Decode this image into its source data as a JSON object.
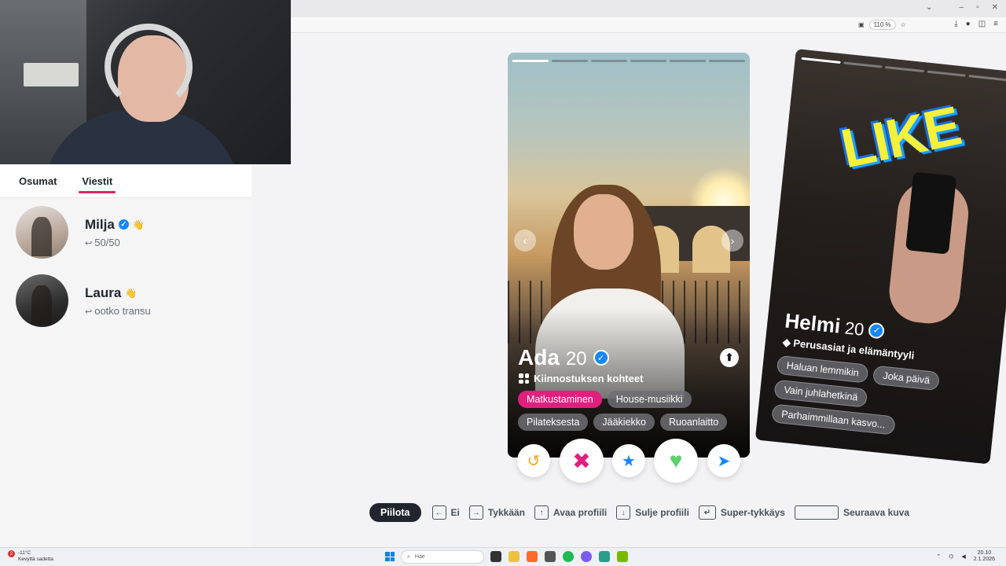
{
  "browser": {
    "zoom": "110 %",
    "tab_menu_icon": "chevron-down-icon",
    "window_controls": [
      "–",
      "▫",
      "✕"
    ]
  },
  "sidebar": {
    "tabs": [
      {
        "label": "Osumat",
        "active": false
      },
      {
        "label": "Viestit",
        "active": true
      }
    ],
    "messages": [
      {
        "name": "Milja",
        "verified": true,
        "preview": "50/50"
      },
      {
        "name": "Laura",
        "verified": false,
        "preview": "ootko transu"
      }
    ]
  },
  "card": {
    "name": "Ada",
    "age": "20",
    "verified": true,
    "interests_title": "Kiinnostuksen kohteet",
    "interests": [
      {
        "label": "Matkustaminen",
        "highlight": true
      },
      {
        "label": "House-musiikki",
        "highlight": false
      },
      {
        "label": "Pilateksesta",
        "highlight": false
      },
      {
        "label": "Jääkiekko",
        "highlight": false
      },
      {
        "label": "Ruoanlaitto",
        "highlight": false
      }
    ],
    "photo_count": 6,
    "photo_index": 1
  },
  "actions": {
    "rewind_icon": "rewind-icon",
    "nope_icon": "x-icon",
    "super_like_icon": "star-icon",
    "like_icon": "heart-icon",
    "boost_icon": "send-icon",
    "colors": {
      "rewind": "#f5a623",
      "nope": "#e0207e",
      "super_like": "#1786ff",
      "like": "#5ad16b",
      "boost": "#1786ff"
    }
  },
  "next_card": {
    "stamp": "LIKE",
    "name": "Helmi",
    "age": "20",
    "subtitle": "Perusasiat ja elämäntyyli",
    "chips": [
      "Haluan lemmikin",
      "Joka päivä",
      "Vain juhlahetkinä",
      "Parhaimmillaan kasvo..."
    ]
  },
  "hints": {
    "hide_label": "Piilota",
    "items": [
      {
        "key": "←",
        "label": "Ei"
      },
      {
        "key": "→",
        "label": "Tykkään"
      },
      {
        "key": "↑",
        "label": "Avaa profiili"
      },
      {
        "key": "↓",
        "label": "Sulje profiili"
      },
      {
        "key": "↵",
        "label": "Super-tykkäys"
      },
      {
        "key": "",
        "label": "Seuraava kuva"
      }
    ]
  },
  "taskbar": {
    "weather_badge": "2",
    "temp": "-11°C",
    "weather_text": "Kevyttä sadetta",
    "search_placeholder": "Hae",
    "time": "20.10",
    "date": "2.1.2026"
  }
}
